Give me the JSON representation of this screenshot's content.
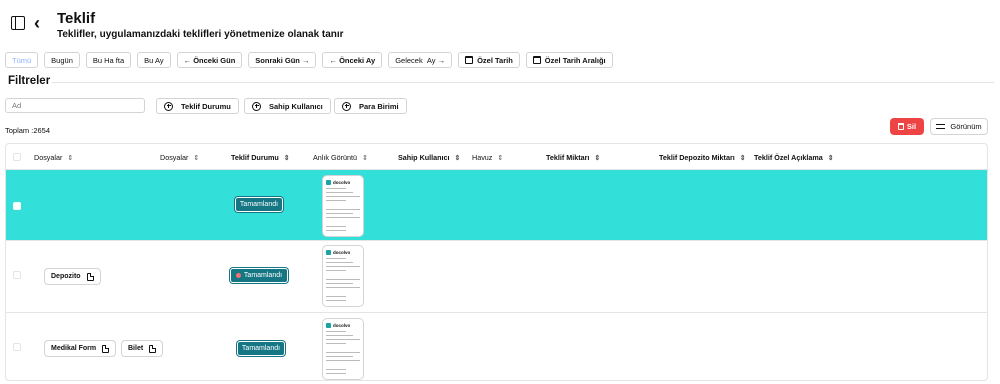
{
  "header": {
    "title": "Teklif",
    "subtitle": "Teklifler, uygulamanızdaki teklifleri yönetmenize olanak tanır"
  },
  "date_filters": {
    "all": "Tümü",
    "today": "Bugün",
    "this_week": "Bu Ha fta",
    "this_month": "Bu Ay",
    "prev_day": "← Önceki Gün",
    "next_day": "Sonraki Gün →",
    "prev_month": "← Önceki Ay",
    "next_month_prefix": "Gelecek",
    "next_month_suffix": "Ay →",
    "custom_date": "Özel Tarih",
    "custom_range": "Özel Tarih Aralığı"
  },
  "filters": {
    "title": "Filtreler",
    "name_placeholder": "Ad",
    "status_button": "Teklif Durumu",
    "owner_button": "Sahip Kullanıcı",
    "currency_button": "Para Birimi"
  },
  "summary": {
    "total": "Toplam :2654",
    "delete_label": "Sil",
    "view_label": "Görünüm"
  },
  "columns": [
    "Dosyalar",
    "Dosyalar",
    "Teklif Durumu",
    "Anlık Görüntü",
    "Sahip Kullanıcı",
    "Havuz",
    "Teklif Miktarı",
    "Teklif Depozito Miktarı",
    "Teklif Özel Açıklama"
  ],
  "thumbnail_brand": "docolvo",
  "rows": [
    {
      "selected": true,
      "files": [],
      "status": "Tamamlandı"
    },
    {
      "selected": false,
      "files": [
        "Depozito"
      ],
      "status": "Tamamlandı"
    },
    {
      "selected": false,
      "files": [
        "Medikal Form",
        "Bilet"
      ],
      "status": "Tamamlandı"
    }
  ],
  "colors": {
    "selected_row": "#33dfd9",
    "status_badge": "#157684",
    "delete_button": "#ef4444",
    "active_filter_text": "#8fb4ff"
  }
}
